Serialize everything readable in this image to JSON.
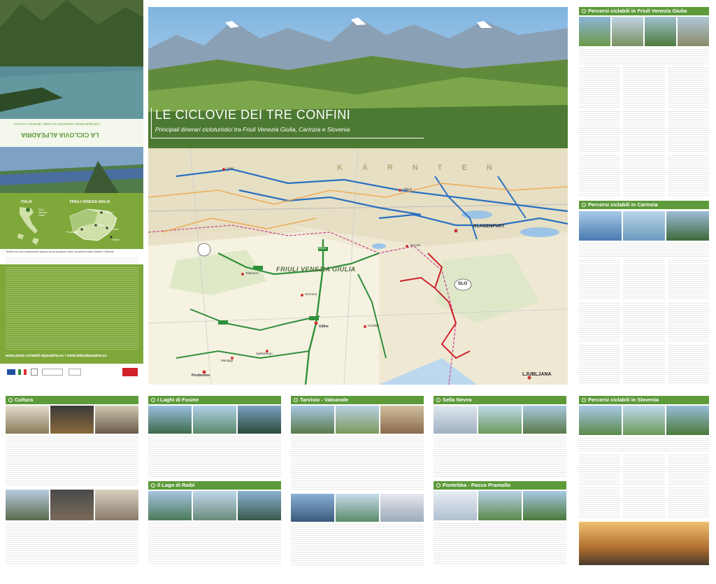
{
  "cover": {
    "title": "LE CICLOVIE DEI TRE CONFINI",
    "subtitle": "Principali itinerari cicloturistici tra Friuli Venezia Giulia, Carinzia e Slovenia"
  },
  "back_panel": {
    "rotated_title": "LA CICLOVIA ALPEADRIA",
    "rotated_sub": "I principali itinerari cicloturistici tra Austria, Slovenia e Carinzia"
  },
  "locator": {
    "italia": "ITALIA",
    "fvg": "FRIULI VENEZIA GIULIA",
    "fvg_small": "Friuli Venezia Giulia",
    "cities": [
      "Tarvisio",
      "Udine",
      "Pordenone",
      "Gorizia",
      "Trieste"
    ]
  },
  "left_text": {
    "intro": "Tarvisio ed il suo comprensorio godono di una posizione unica, crocevia tra Italia, Austria e Slovenia.",
    "website": "www.piste-ciclabili-alpeadria.eu  /  www.bikealpeadria.eu"
  },
  "map": {
    "region_label": "FRIULI VENEZIA GIULIA",
    "karnten": "KÄRNTEN",
    "klagenfurt": "KLAGENFURT",
    "slo": "SLO",
    "ljubljana": "LJUBLJANA",
    "places": [
      "Lienz",
      "Villach",
      "Tolmezzo",
      "Tarvisio",
      "Gemona",
      "Udine",
      "Cividale",
      "Spilimbergo",
      "Maniago",
      "Pordenone"
    ],
    "route_label": "FVG 1"
  },
  "right_panels": [
    {
      "title": "Percorsi ciclabili in Friuli Venezia Giulia"
    },
    {
      "title": "Percorsi ciclabili in Carinzia"
    }
  ],
  "bottom_panels": [
    {
      "title": "Cultura"
    },
    {
      "title": "I Laghi di Fusine"
    },
    {
      "title": "Tarvisio - Valcanale"
    },
    {
      "title": "Sella Nevea"
    },
    {
      "title": "Percorsi ciclabili in Slovenia"
    },
    {
      "title": "Il Lago di Raibl"
    },
    {
      "title": "Pontebba - Passo Pramollo"
    }
  ],
  "colors": {
    "accent": "#5d9a3a",
    "left_panel": "#7fa83a",
    "route_red": "#d0202a",
    "route_blue": "#2a6fc0"
  }
}
